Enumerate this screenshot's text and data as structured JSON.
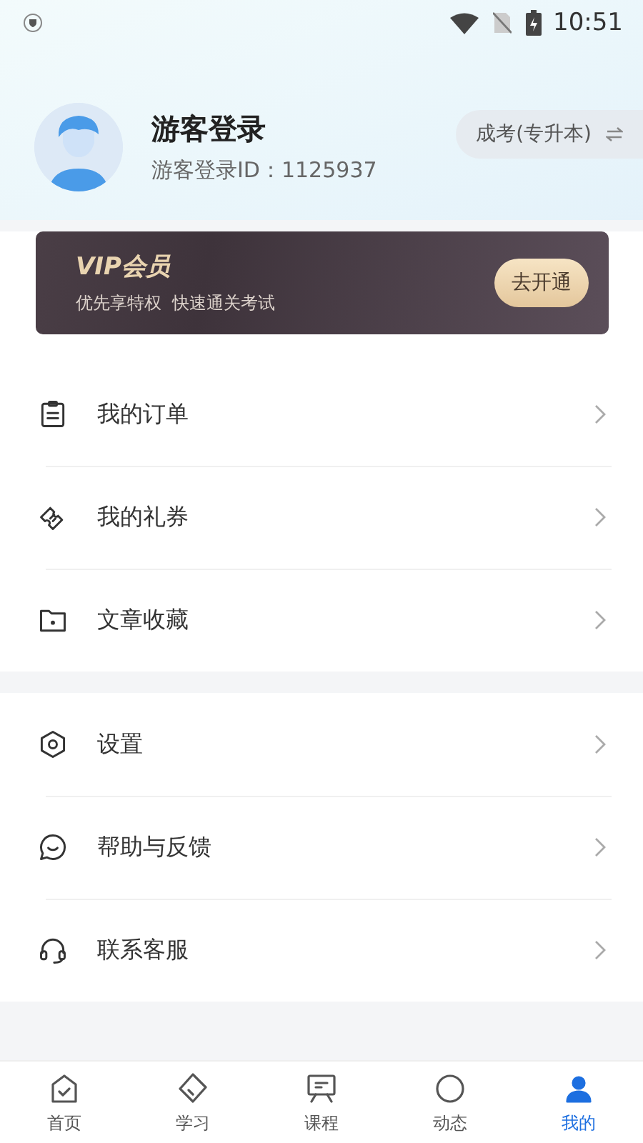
{
  "status_bar": {
    "time": "10:51"
  },
  "profile": {
    "name": "游客登录",
    "user_id": "游客登录ID：1125937",
    "exam_switch": "成考(专升本)"
  },
  "vip_card": {
    "title": "VIP会员",
    "subtitle": "优先享特权  快速通关考试",
    "button": "去开通"
  },
  "menu_groups": [
    {
      "items": [
        {
          "label": "我的订单"
        },
        {
          "label": "我的礼券"
        },
        {
          "label": "文章收藏"
        }
      ]
    },
    {
      "items": [
        {
          "label": "设置"
        },
        {
          "label": "帮助与反馈"
        },
        {
          "label": "联系客服"
        }
      ]
    }
  ],
  "tab_bar": [
    {
      "label": "首页",
      "selected": false
    },
    {
      "label": "学习",
      "selected": false
    },
    {
      "label": "课程",
      "selected": false
    },
    {
      "label": "动态",
      "selected": false
    },
    {
      "label": "我的",
      "selected": true
    }
  ]
}
